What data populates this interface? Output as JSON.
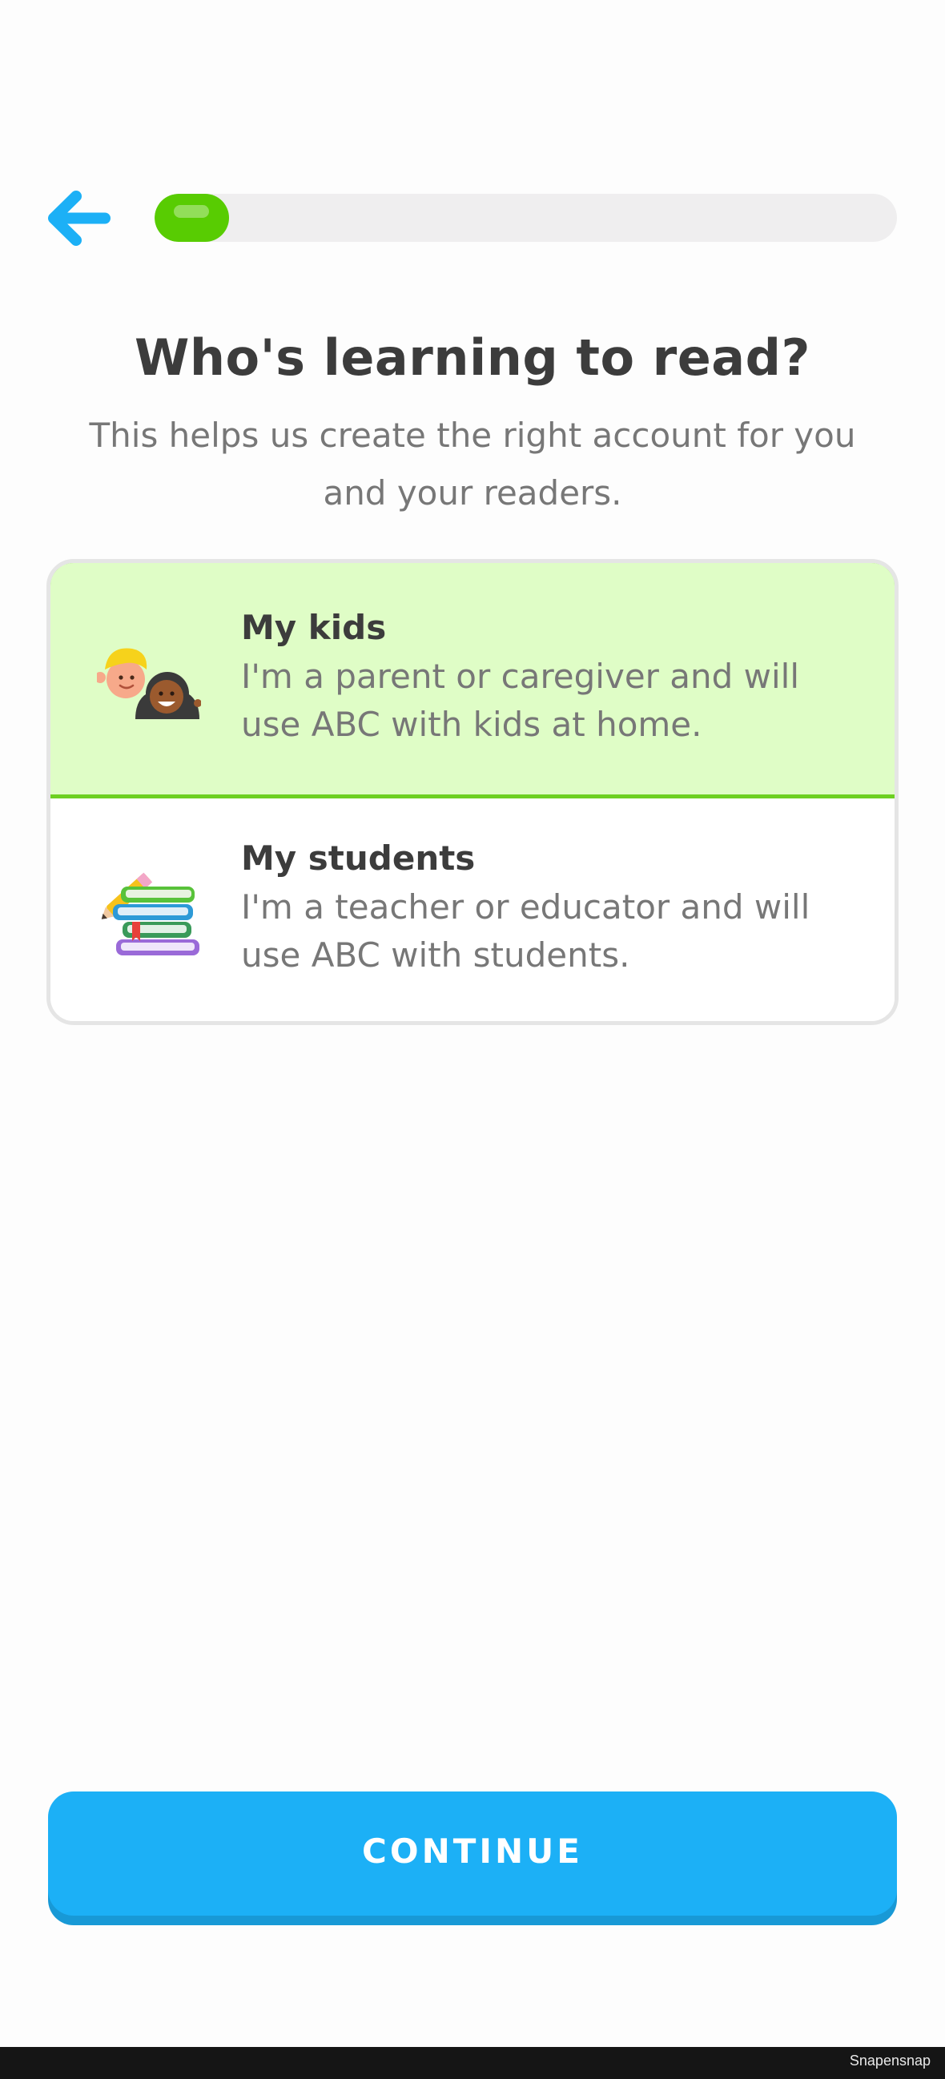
{
  "header": {
    "back_icon": "arrow-left-icon",
    "progress_fraction": 0.1
  },
  "title": "Who's learning to read?",
  "subtitle": "This helps us create the right account for you and your readers.",
  "options": [
    {
      "icon": "kids-faces-icon",
      "title": "My kids",
      "description": "I'm a parent or caregiver and will use ABC with kids at home.",
      "selected": true
    },
    {
      "icon": "books-pencil-icon",
      "title": "My students",
      "description": "I'm a teacher or educator and will use ABC with students.",
      "selected": false
    }
  ],
  "continue_label": "CONTINUE",
  "watermark": "Snapensnap",
  "colors": {
    "accent_blue": "#1cb0f6",
    "progress_green": "#58cc02",
    "selected_bg": "#dffdc6",
    "selected_border": "#6dd021"
  }
}
